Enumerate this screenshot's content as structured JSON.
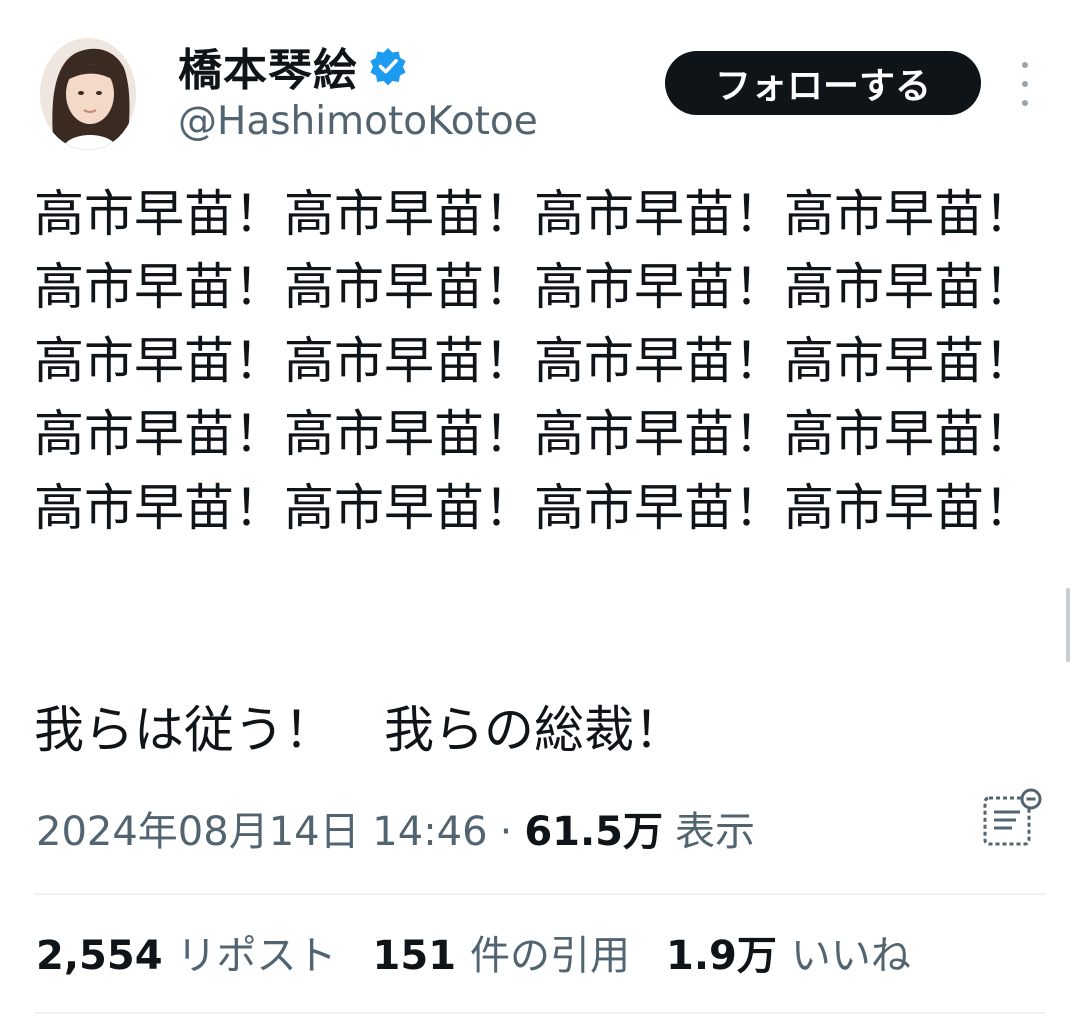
{
  "user": {
    "display_name": "橋本琴絵",
    "handle": "@HashimotoKotoe",
    "verified_icon": "verified-badge-icon",
    "verified_color": "#1d9bf0"
  },
  "actions": {
    "follow_label": "フォローする",
    "more_icon": "more-vertical-icon"
  },
  "tweet": {
    "text": "高市早苗！高市早苗！高市早苗！高市早苗！高市早苗！高市早苗！高市早苗！高市早苗！高市早苗！高市早苗！高市早苗！高市早苗！高市早苗！高市早苗！高市早苗！高市早苗！高市早苗！高市早苗！高市早苗！高市早苗！",
    "text2": "我らは従う！　我らの総裁！"
  },
  "meta": {
    "timestamp": "2024年08月14日 14:46",
    "separator": "·",
    "views_count": "61.5万",
    "views_label": "表示",
    "analytics_icon": "analytics-icon"
  },
  "stats": {
    "reposts_count": "2,554",
    "reposts_label": "リポスト",
    "quotes_count": "151",
    "quotes_label": "件の引用",
    "likes_count": "1.9万",
    "likes_label": "いいね"
  },
  "colors": {
    "text_primary": "#0f1419",
    "text_secondary": "#536471",
    "follow_button_bg": "#0f1419",
    "divider": "#eff3f4"
  }
}
